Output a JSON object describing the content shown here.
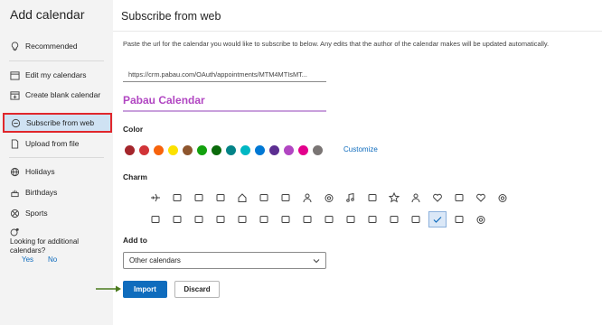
{
  "sidebar": {
    "title": "Add calendar",
    "items": [
      {
        "label": "Recommended",
        "icon": "lightbulb-icon"
      },
      {
        "label": "Edit my calendars",
        "icon": "calendar-edit-icon"
      },
      {
        "label": "Create blank calendar",
        "icon": "calendar-add-icon"
      },
      {
        "label": "Subscribe from web",
        "icon": "globe-icon",
        "selected": true
      },
      {
        "label": "Upload from file",
        "icon": "document-icon"
      },
      {
        "label": "Holidays",
        "icon": "globe-icon"
      },
      {
        "label": "Birthdays",
        "icon": "cake-icon"
      },
      {
        "label": "Sports",
        "icon": "sports-icon"
      }
    ],
    "more_text": "Looking for additional calendars?",
    "yes_label": "Yes",
    "no_label": "No"
  },
  "main": {
    "title": "Subscribe from web",
    "description": "Paste the url for the calendar you would like to subscribe to below. Any edits that the author of the calendar makes will be updated automatically.",
    "url_value": "https://crm.pabau.com/OAuth/appointments/MTM4MTIsMT...",
    "calendar_name": "Pabau Calendar",
    "color_label": "Color",
    "colors": [
      "#a4262c",
      "#d13438",
      "#f7630c",
      "#fce100",
      "#8e562e",
      "#13a10e",
      "#0b6a0b",
      "#038387",
      "#00b7c3",
      "#0078d4",
      "#5c2e91",
      "#b146c2",
      "#e3008c",
      "#7a7574"
    ],
    "customize_label": "Customize",
    "charm_label": "Charm",
    "charm_icons_row1": [
      "airplane-icon",
      "notes-icon",
      "camera-icon",
      "controller-icon",
      "home-icon",
      "pill-icon",
      "briefcase-icon",
      "people-icon",
      "stopwatch-icon",
      "music-icon",
      "car-icon",
      "star-icon",
      "person-icon",
      "heart-broken-icon",
      "utensils-icon",
      "heart-icon",
      "soccer-ball-icon"
    ],
    "charm_icons_row2": [
      "clapper-icon",
      "book-icon",
      "cake-icon",
      "monitor-icon",
      "bus-icon",
      "credit-card-icon",
      "bike-icon",
      "train-icon",
      "graduation-cap-icon",
      "dumbbell-icon",
      "plant-icon",
      "wrench-icon",
      "phone-icon",
      "check-icon",
      "clipboard-icon",
      "target-icon"
    ],
    "add_to_label": "Add to",
    "add_to_value": "Other calendars",
    "import_label": "Import",
    "discard_label": "Discard"
  },
  "accent_color": "#0f6cbd",
  "highlight_color": "#e0262b"
}
